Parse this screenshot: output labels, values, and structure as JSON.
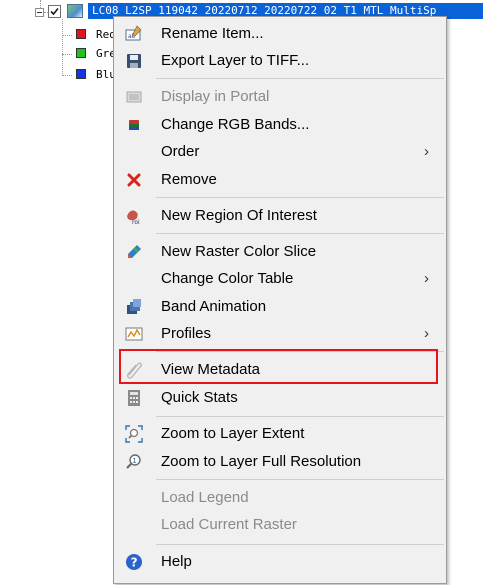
{
  "tree": {
    "layer_label": "LC08_L2SP_119042_20220712_20220722_02_T1_MTL_MultiSp",
    "bands": [
      {
        "label": "Red",
        "color": "#e0141b"
      },
      {
        "label": "Green",
        "color": "#1ec31e"
      },
      {
        "label": "Blue",
        "color": "#1733e6"
      }
    ]
  },
  "menu": {
    "items": [
      {
        "label": "Rename Item...",
        "icon": "rename-icon",
        "enabled": true
      },
      {
        "label": "Export Layer to TIFF...",
        "icon": "save-icon",
        "enabled": true
      },
      {
        "label": "Display in Portal",
        "icon": "portal-icon",
        "enabled": false
      },
      {
        "label": "Change RGB Bands...",
        "icon": "rgb-bands-icon",
        "enabled": true
      },
      {
        "label": "Order",
        "icon": "",
        "enabled": true,
        "submenu": true
      },
      {
        "label": "Remove",
        "icon": "remove-icon",
        "enabled": true
      },
      {
        "label": "New Region Of Interest",
        "icon": "roi-icon",
        "enabled": true
      },
      {
        "label": "New Raster Color Slice",
        "icon": "color-slice-icon",
        "enabled": true
      },
      {
        "label": "Change Color Table",
        "icon": "",
        "enabled": true,
        "submenu": true
      },
      {
        "label": "Band Animation",
        "icon": "band-animation-icon",
        "enabled": true
      },
      {
        "label": "Profiles",
        "icon": "profiles-icon",
        "enabled": true,
        "submenu": true
      },
      {
        "label": "View Metadata",
        "icon": "metadata-icon",
        "enabled": true
      },
      {
        "label": "Quick Stats",
        "icon": "calculator-icon",
        "enabled": true
      },
      {
        "label": "Zoom to Layer Extent",
        "icon": "zoom-extent-icon",
        "enabled": true
      },
      {
        "label": "Zoom to Layer Full Resolution",
        "icon": "zoom-full-res-icon",
        "enabled": true
      },
      {
        "label": "Load Legend",
        "icon": "",
        "enabled": false
      },
      {
        "label": "Load Current Raster",
        "icon": "",
        "enabled": false
      },
      {
        "label": "Help",
        "icon": "help-icon",
        "enabled": true
      }
    ],
    "submenu_arrow": "›"
  },
  "colors": {
    "highlight_border": "#e8141b",
    "selection": "#0a62d8"
  }
}
